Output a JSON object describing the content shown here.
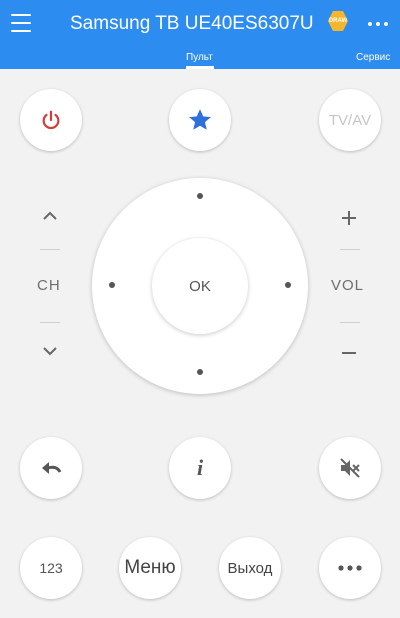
{
  "header": {
    "title": "Samsung TB UE40ES6307U",
    "badge_text": "DRAW",
    "tabs": [
      {
        "label": "Пульт",
        "active": true
      },
      {
        "label": "Сервис",
        "active": false
      }
    ],
    "accent_color": "#2d8cf0"
  },
  "remote": {
    "power_icon": "power-icon",
    "favorite_icon": "star-icon",
    "tvav_label": "TV/AV",
    "ch_label": "CH",
    "vol_label": "VOL",
    "ok_label": "OK",
    "back_icon": "back-arrow-icon",
    "info_label": "i",
    "mute_icon": "mute-icon",
    "num_label": "123",
    "menu_label": "Меню",
    "exit_label": "Выход",
    "more_icon": "more-dots-icon",
    "power_color": "#d23c3c",
    "star_color": "#2f6fdc"
  }
}
